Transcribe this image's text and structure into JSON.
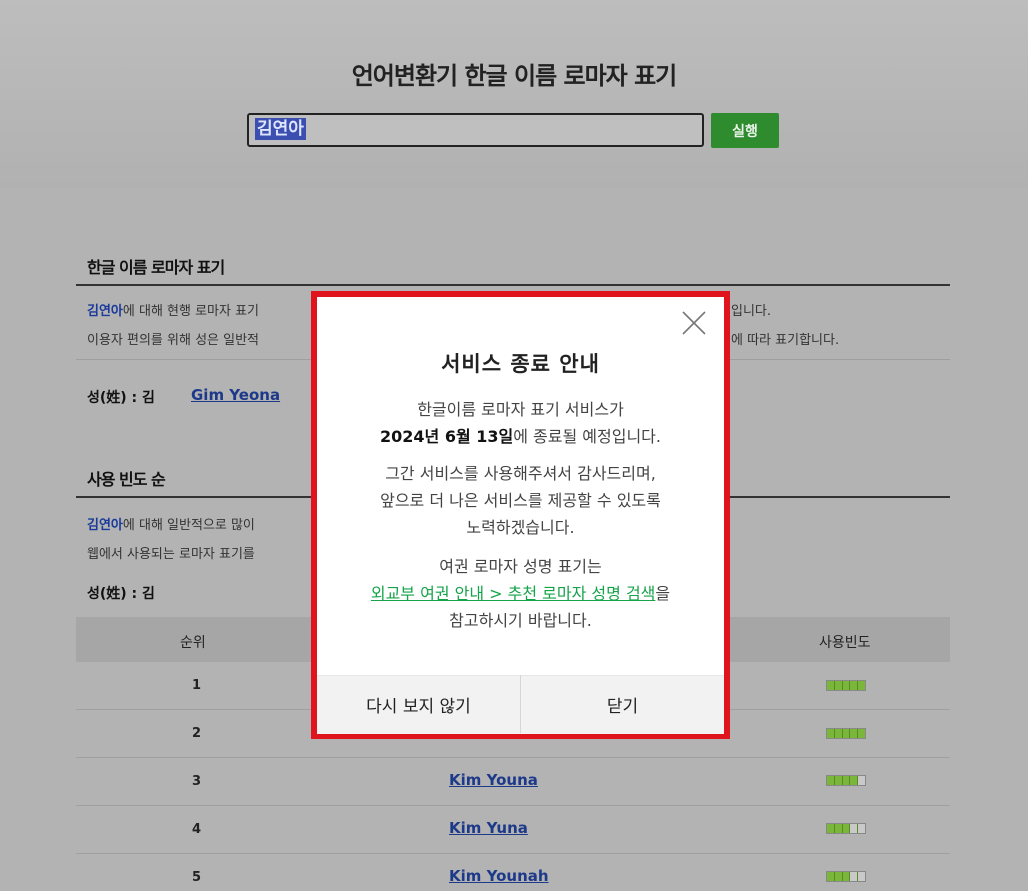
{
  "header": {
    "title": "언어변환기 한글 이름 로마자 표기"
  },
  "search": {
    "value": "김연아",
    "run_label": "실행"
  },
  "section1": {
    "title": "한글 이름 로마자 표기",
    "line1_name": "김연아",
    "line1_text": "에 대해 현행 로마자 표기",
    "line1_tail": "입니다.",
    "line2_text": "이용자 편의를 위해 성은 일반적",
    "line2_tail": "에 따라 표기합니다.",
    "surname_label": "성(姓) : 김",
    "surname_roman": "Gim Yeona"
  },
  "section2": {
    "title": "사용 빈도 순",
    "line1_name": "김연아",
    "line1_text": "에 대해 일반적으로 많이",
    "line2_text": "웹에서 사용되는 로마자 표기를",
    "surname_label": "성(姓) : 김",
    "col_rank": "순위",
    "col_freq": "사용빈도",
    "rows": [
      {
        "rank": "1",
        "name": "",
        "freq": 5
      },
      {
        "rank": "2",
        "name": "",
        "freq": 5
      },
      {
        "rank": "3",
        "name": "Kim Youna",
        "freq": 4
      },
      {
        "rank": "4",
        "name": "Kim Yuna",
        "freq": 3
      },
      {
        "rank": "5",
        "name": "Kim Younah",
        "freq": 3
      }
    ]
  },
  "modal": {
    "title": "서비스 종료 안내",
    "p1_line1": "한글이름 로마자 표기 서비스가",
    "p1_date": "2024년 6월 13일",
    "p1_line2_tail": "에 종료될 예정입니다.",
    "p2_line1": "그간 서비스를 사용해주셔서 감사드리며,",
    "p2_line2": "앞으로 더 나은 서비스를 제공할 수 있도록",
    "p2_line3": "노력하겠습니다.",
    "p3_line1": "여권 로마자 성명 표기는",
    "p3_link": "외교부 여권 안내 > 추천 로마자 성명 검색",
    "p3_link_tail": "을",
    "p3_line3": "참고하시기 바랍니다.",
    "dont_show_label": "다시 보지 않기",
    "close_label": "닫기",
    "frame_color": "#e0141c",
    "link_color": "#16a34a"
  }
}
